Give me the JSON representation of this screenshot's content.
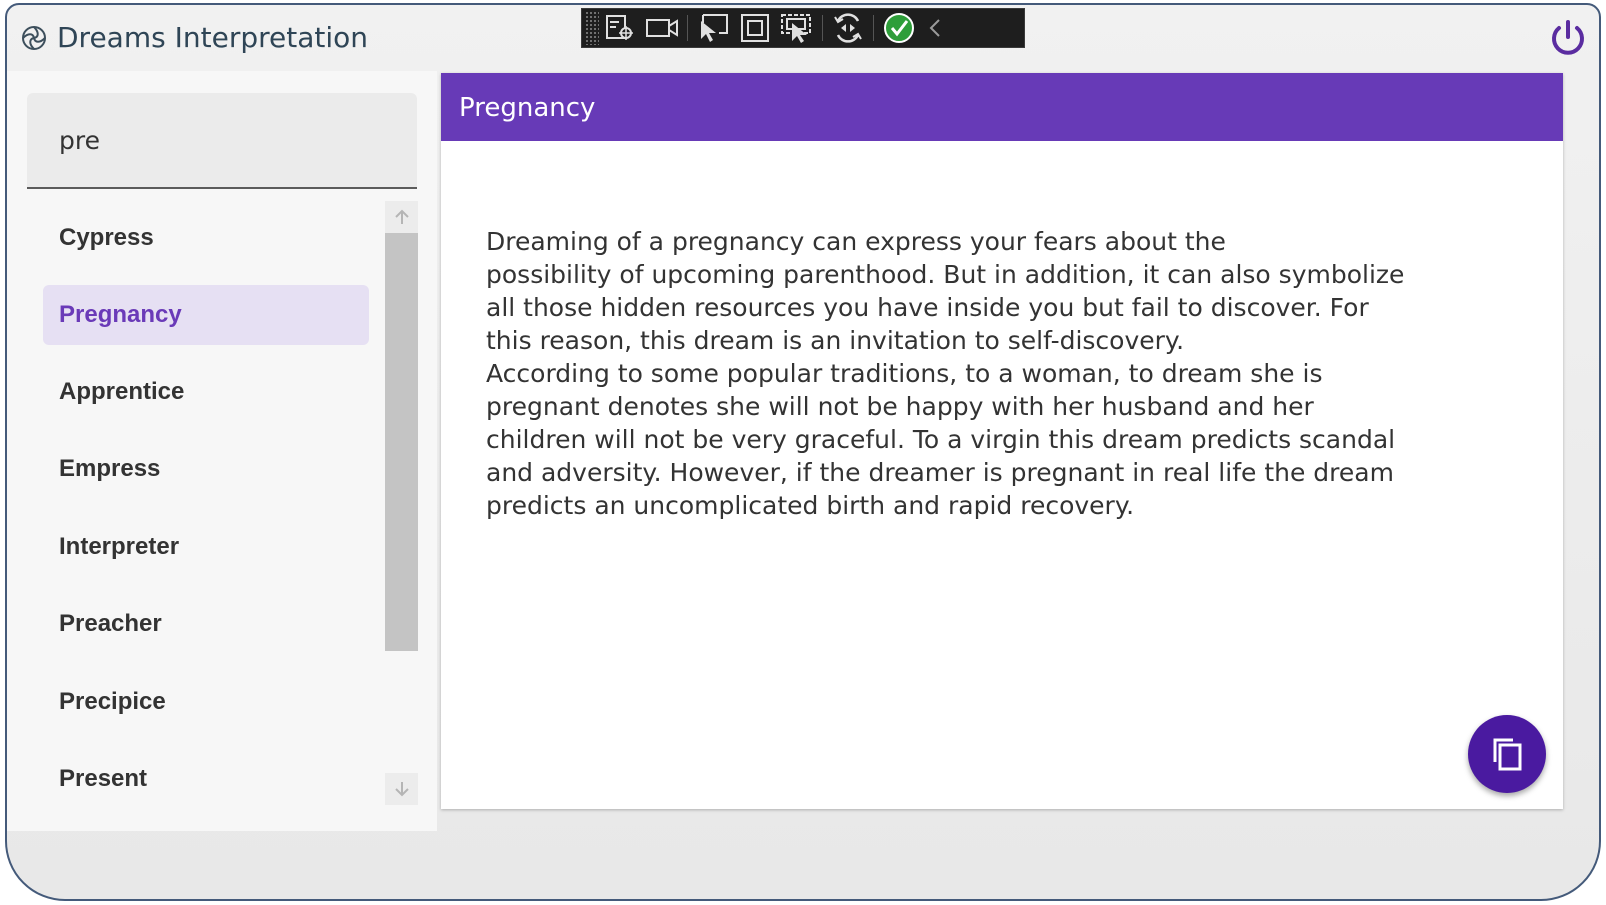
{
  "app": {
    "title": "Dreams Interpretation",
    "accent_color": "#673ab7",
    "fab_color": "#4a1aa0",
    "power_color": "#5a2ca0"
  },
  "dev_toolbar": {
    "buttons": [
      {
        "icon": "live-visual-tree-icon"
      },
      {
        "icon": "record-icon"
      },
      {
        "icon": "select-element-icon"
      },
      {
        "icon": "display-layout-adorners-icon"
      },
      {
        "icon": "track-focused-element-icon"
      },
      {
        "icon": "hot-reload-icon"
      },
      {
        "icon": "binding-failures-ok-icon"
      },
      {
        "icon": "collapse-toolbar-icon"
      }
    ]
  },
  "sidebar": {
    "search": {
      "value": "pre"
    },
    "items": [
      {
        "label": "Cypress",
        "selected": false
      },
      {
        "label": "Pregnancy",
        "selected": true
      },
      {
        "label": "Apprentice",
        "selected": false
      },
      {
        "label": "Empress",
        "selected": false
      },
      {
        "label": "Interpreter",
        "selected": false
      },
      {
        "label": "Preacher",
        "selected": false
      },
      {
        "label": "Precipice",
        "selected": false
      },
      {
        "label": "Present",
        "selected": false
      }
    ]
  },
  "content": {
    "title": "Pregnancy",
    "body": "Dreaming of a pregnancy can express your fears about the\npossibility of upcoming parenthood. But in addition, it can also symbolize all those hidden resources you have inside you but fail to discover. For this reason, this dream is an invitation to self-discovery.\nAccording to some popular traditions, to a woman, to dream she is pregnant denotes she will not be happy with her husband and her children will not be very graceful. To a virgin this dream predicts scandal and adversity. However, if the dreamer is pregnant in real life the dream predicts an uncomplicated birth and rapid recovery."
  },
  "fab": {
    "icon": "copy-icon"
  }
}
